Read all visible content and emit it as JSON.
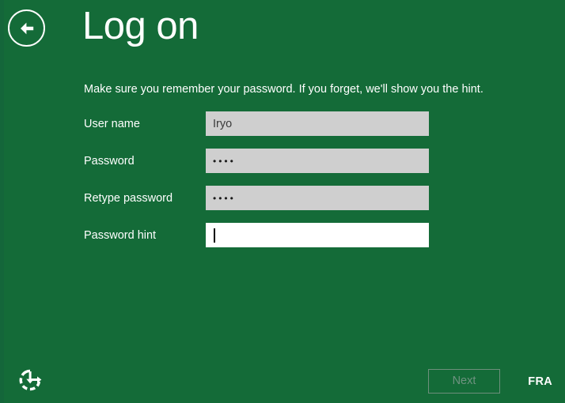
{
  "window": {
    "title": "Log on",
    "background_color": "#146b38"
  },
  "header": {
    "back_button_icon": "arrow-left-circle-icon",
    "title": "Log on"
  },
  "main": {
    "subtitle": "Make sure you remember your password. If you forget, we'll show you the hint.",
    "fields": [
      {
        "label": "User name",
        "value": "Iryo",
        "placeholder": "",
        "masked": false,
        "focused": false,
        "state": "filled"
      },
      {
        "label": "Password",
        "value": "••••",
        "placeholder": "",
        "masked": true,
        "focused": false,
        "state": "filled"
      },
      {
        "label": "Retype password",
        "value": "••••",
        "placeholder": "",
        "masked": true,
        "focused": false,
        "state": "filled"
      },
      {
        "label": "Password hint",
        "value": "",
        "placeholder": "",
        "masked": false,
        "focused": true,
        "state": "empty-focused"
      }
    ]
  },
  "footer": {
    "ease_of_access_icon": "ease-of-access-icon",
    "next_label": "Next",
    "next_enabled": false,
    "locale": "FRA"
  },
  "colors": {
    "background": "#146b38",
    "field_background": "#cfcfcf",
    "field_background_focused": "#ffffff",
    "text_on_green": "#ffffff",
    "disabled_button_text": "#6f9280",
    "disabled_button_border": "#6d8f7c"
  }
}
